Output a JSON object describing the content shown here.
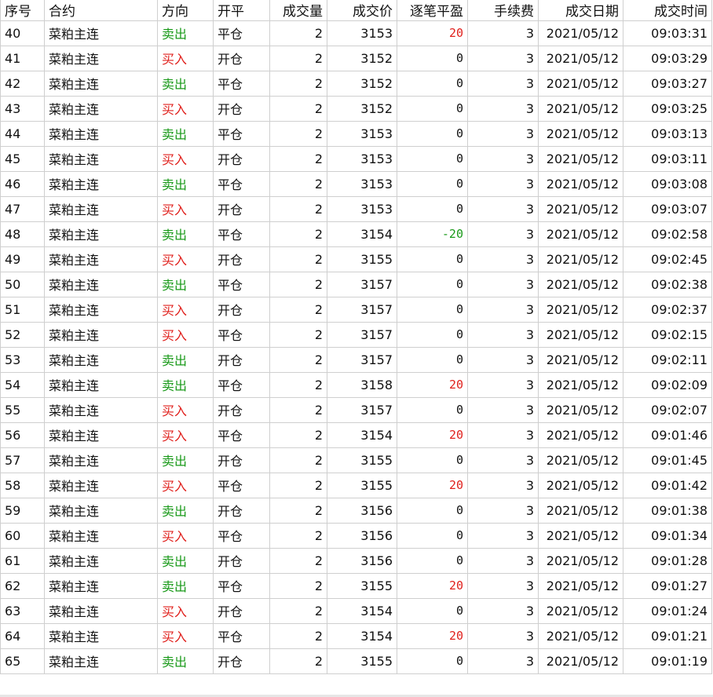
{
  "colors": {
    "buy": "#e0201c",
    "sell": "#1a9a1a",
    "profit_positive": "#e0201c",
    "profit_negative": "#1a9a1a",
    "grid_line": "#cfcfcf"
  },
  "columns": {
    "seq": "序号",
    "contract": "合约",
    "direction": "方向",
    "offset": "开平",
    "volume": "成交量",
    "price": "成交价",
    "pnl": "逐笔平盈",
    "fee": "手续费",
    "date": "成交日期",
    "time": "成交时间"
  },
  "rows": [
    {
      "seq": "40",
      "contract": "菜粕主连",
      "direction": "卖出",
      "side": "sell",
      "offset": "平仓",
      "volume": "2",
      "price": "3153",
      "pnl": "20",
      "fee": "3",
      "date": "2021/05/12",
      "time": "09:03:31"
    },
    {
      "seq": "41",
      "contract": "菜粕主连",
      "direction": "买入",
      "side": "buy",
      "offset": "开仓",
      "volume": "2",
      "price": "3152",
      "pnl": "0",
      "fee": "3",
      "date": "2021/05/12",
      "time": "09:03:29"
    },
    {
      "seq": "42",
      "contract": "菜粕主连",
      "direction": "卖出",
      "side": "sell",
      "offset": "平仓",
      "volume": "2",
      "price": "3152",
      "pnl": "0",
      "fee": "3",
      "date": "2021/05/12",
      "time": "09:03:27"
    },
    {
      "seq": "43",
      "contract": "菜粕主连",
      "direction": "买入",
      "side": "buy",
      "offset": "开仓",
      "volume": "2",
      "price": "3152",
      "pnl": "0",
      "fee": "3",
      "date": "2021/05/12",
      "time": "09:03:25"
    },
    {
      "seq": "44",
      "contract": "菜粕主连",
      "direction": "卖出",
      "side": "sell",
      "offset": "平仓",
      "volume": "2",
      "price": "3153",
      "pnl": "0",
      "fee": "3",
      "date": "2021/05/12",
      "time": "09:03:13"
    },
    {
      "seq": "45",
      "contract": "菜粕主连",
      "direction": "买入",
      "side": "buy",
      "offset": "开仓",
      "volume": "2",
      "price": "3153",
      "pnl": "0",
      "fee": "3",
      "date": "2021/05/12",
      "time": "09:03:11"
    },
    {
      "seq": "46",
      "contract": "菜粕主连",
      "direction": "卖出",
      "side": "sell",
      "offset": "平仓",
      "volume": "2",
      "price": "3153",
      "pnl": "0",
      "fee": "3",
      "date": "2021/05/12",
      "time": "09:03:08"
    },
    {
      "seq": "47",
      "contract": "菜粕主连",
      "direction": "买入",
      "side": "buy",
      "offset": "开仓",
      "volume": "2",
      "price": "3153",
      "pnl": "0",
      "fee": "3",
      "date": "2021/05/12",
      "time": "09:03:07"
    },
    {
      "seq": "48",
      "contract": "菜粕主连",
      "direction": "卖出",
      "side": "sell",
      "offset": "平仓",
      "volume": "2",
      "price": "3154",
      "pnl": "-20",
      "fee": "3",
      "date": "2021/05/12",
      "time": "09:02:58"
    },
    {
      "seq": "49",
      "contract": "菜粕主连",
      "direction": "买入",
      "side": "buy",
      "offset": "开仓",
      "volume": "2",
      "price": "3155",
      "pnl": "0",
      "fee": "3",
      "date": "2021/05/12",
      "time": "09:02:45"
    },
    {
      "seq": "50",
      "contract": "菜粕主连",
      "direction": "卖出",
      "side": "sell",
      "offset": "平仓",
      "volume": "2",
      "price": "3157",
      "pnl": "0",
      "fee": "3",
      "date": "2021/05/12",
      "time": "09:02:38"
    },
    {
      "seq": "51",
      "contract": "菜粕主连",
      "direction": "买入",
      "side": "buy",
      "offset": "开仓",
      "volume": "2",
      "price": "3157",
      "pnl": "0",
      "fee": "3",
      "date": "2021/05/12",
      "time": "09:02:37"
    },
    {
      "seq": "52",
      "contract": "菜粕主连",
      "direction": "买入",
      "side": "buy",
      "offset": "平仓",
      "volume": "2",
      "price": "3157",
      "pnl": "0",
      "fee": "3",
      "date": "2021/05/12",
      "time": "09:02:15"
    },
    {
      "seq": "53",
      "contract": "菜粕主连",
      "direction": "卖出",
      "side": "sell",
      "offset": "开仓",
      "volume": "2",
      "price": "3157",
      "pnl": "0",
      "fee": "3",
      "date": "2021/05/12",
      "time": "09:02:11"
    },
    {
      "seq": "54",
      "contract": "菜粕主连",
      "direction": "卖出",
      "side": "sell",
      "offset": "平仓",
      "volume": "2",
      "price": "3158",
      "pnl": "20",
      "fee": "3",
      "date": "2021/05/12",
      "time": "09:02:09"
    },
    {
      "seq": "55",
      "contract": "菜粕主连",
      "direction": "买入",
      "side": "buy",
      "offset": "开仓",
      "volume": "2",
      "price": "3157",
      "pnl": "0",
      "fee": "3",
      "date": "2021/05/12",
      "time": "09:02:07"
    },
    {
      "seq": "56",
      "contract": "菜粕主连",
      "direction": "买入",
      "side": "buy",
      "offset": "平仓",
      "volume": "2",
      "price": "3154",
      "pnl": "20",
      "fee": "3",
      "date": "2021/05/12",
      "time": "09:01:46"
    },
    {
      "seq": "57",
      "contract": "菜粕主连",
      "direction": "卖出",
      "side": "sell",
      "offset": "开仓",
      "volume": "2",
      "price": "3155",
      "pnl": "0",
      "fee": "3",
      "date": "2021/05/12",
      "time": "09:01:45"
    },
    {
      "seq": "58",
      "contract": "菜粕主连",
      "direction": "买入",
      "side": "buy",
      "offset": "平仓",
      "volume": "2",
      "price": "3155",
      "pnl": "20",
      "fee": "3",
      "date": "2021/05/12",
      "time": "09:01:42"
    },
    {
      "seq": "59",
      "contract": "菜粕主连",
      "direction": "卖出",
      "side": "sell",
      "offset": "开仓",
      "volume": "2",
      "price": "3156",
      "pnl": "0",
      "fee": "3",
      "date": "2021/05/12",
      "time": "09:01:38"
    },
    {
      "seq": "60",
      "contract": "菜粕主连",
      "direction": "买入",
      "side": "buy",
      "offset": "平仓",
      "volume": "2",
      "price": "3156",
      "pnl": "0",
      "fee": "3",
      "date": "2021/05/12",
      "time": "09:01:34"
    },
    {
      "seq": "61",
      "contract": "菜粕主连",
      "direction": "卖出",
      "side": "sell",
      "offset": "开仓",
      "volume": "2",
      "price": "3156",
      "pnl": "0",
      "fee": "3",
      "date": "2021/05/12",
      "time": "09:01:28"
    },
    {
      "seq": "62",
      "contract": "菜粕主连",
      "direction": "卖出",
      "side": "sell",
      "offset": "平仓",
      "volume": "2",
      "price": "3155",
      "pnl": "20",
      "fee": "3",
      "date": "2021/05/12",
      "time": "09:01:27"
    },
    {
      "seq": "63",
      "contract": "菜粕主连",
      "direction": "买入",
      "side": "buy",
      "offset": "开仓",
      "volume": "2",
      "price": "3154",
      "pnl": "0",
      "fee": "3",
      "date": "2021/05/12",
      "time": "09:01:24"
    },
    {
      "seq": "64",
      "contract": "菜粕主连",
      "direction": "买入",
      "side": "buy",
      "offset": "平仓",
      "volume": "2",
      "price": "3154",
      "pnl": "20",
      "fee": "3",
      "date": "2021/05/12",
      "time": "09:01:21"
    },
    {
      "seq": "65",
      "contract": "菜粕主连",
      "direction": "卖出",
      "side": "sell",
      "offset": "开仓",
      "volume": "2",
      "price": "3155",
      "pnl": "0",
      "fee": "3",
      "date": "2021/05/12",
      "time": "09:01:19"
    }
  ]
}
